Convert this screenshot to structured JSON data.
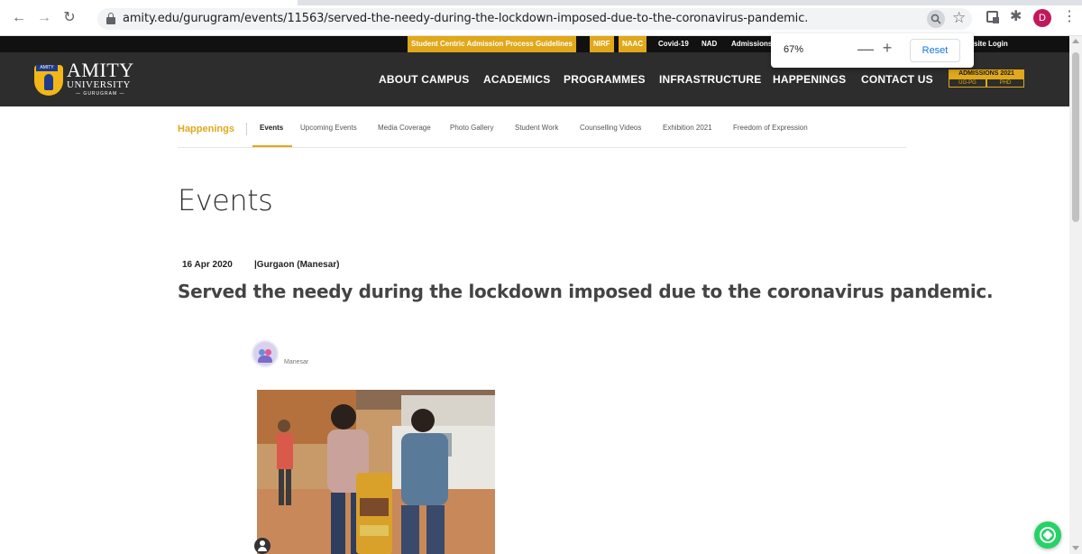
{
  "browser": {
    "url": "amity.edu/gurugram/events/11563/served-the-needy-during-the-lockdown-imposed-due-to-the-coronavirus-pandemic.",
    "profile_initial": "D",
    "profile_color": "#c2185b",
    "icons": [
      "back-icon",
      "forward-icon",
      "reload-icon",
      "lock-icon",
      "zoom-icon",
      "star-icon",
      "extension-icon",
      "puzzle-icon",
      "kebab-menu-icon"
    ]
  },
  "zoom_popup": {
    "value": "67%",
    "minus": "—",
    "plus": "+",
    "reset": "Reset"
  },
  "top_strip": {
    "items": [
      "Student Centric Admission Process Guidelines",
      "NIRF",
      "NAAC",
      "Covid-19",
      "NAD",
      "Admissions",
      "site Login"
    ]
  },
  "header": {
    "logo": {
      "line1": "AMITY",
      "line2": "UNIVERSITY",
      "line3": "— GURUGRAM —",
      "tag": "AMITY"
    },
    "nav": [
      "ABOUT CAMPUS",
      "ACADEMICS",
      "PROGRAMMES",
      "INFRASTRUCTURE",
      "HAPPENINGS",
      "CONTACT US"
    ],
    "admissions": {
      "title": "ADMISSIONS 2021",
      "left": "UG-PG",
      "right": "PHD"
    }
  },
  "subnav": {
    "home": "Happenings",
    "items": [
      "Events",
      "Upcoming Events",
      "Media Coverage",
      "Photo Gallery",
      "Student Work",
      "Counselling Videos",
      "Exhibition 2021",
      "Freedom of Expression"
    ],
    "active": "Events"
  },
  "content": {
    "page_title": "Events",
    "date": "16 Apr 2020",
    "location": "|Gurgaon (Manesar)",
    "event_title": "Served the needy during the lockdown imposed due to the coronavirus pandemic.",
    "post_user": "Manesar"
  },
  "colors": {
    "accent": "#e0a81a",
    "header_bg": "#2d2d2d",
    "top_strip_bg": "#111111",
    "whatsapp": "#25d366"
  }
}
